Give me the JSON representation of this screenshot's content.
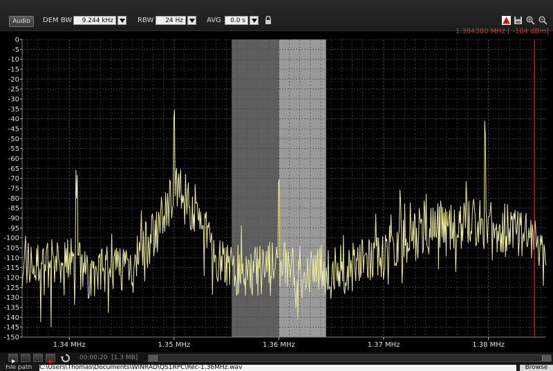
{
  "toolbar": {
    "audio_label": "Audio",
    "dem_bw_label": "DEM BW",
    "dem_bw_value": "9.244 kHz",
    "rbw_label": "RBW",
    "rbw_value": "24 Hz",
    "avg_label": "AVG",
    "avg_value": "0.0 s",
    "cursor_readout": "1.384380 MHz [ -104 dBm]"
  },
  "chart_data": {
    "type": "line",
    "xlabel": "",
    "ylabel": "",
    "xlim": [
      1.3355,
      1.3855
    ],
    "ylim": [
      -150,
      0
    ],
    "x_ticks": [
      "1.34 MHz",
      "1.35 MHz",
      "1.36 MHz",
      "1.37 MHz",
      "1.38 MHz"
    ],
    "x_tick_values": [
      1.34,
      1.35,
      1.36,
      1.37,
      1.38
    ],
    "y_ticks": [
      0,
      -5,
      -10,
      -15,
      -20,
      -25,
      -30,
      -35,
      -40,
      -45,
      -50,
      -55,
      -60,
      -65,
      -70,
      -75,
      -80,
      -85,
      -90,
      -95,
      -100,
      -105,
      -110,
      -115,
      -120,
      -125,
      -130,
      -135,
      -140,
      -145,
      -150
    ],
    "grid": true,
    "filter_band_low": [
      1.3555,
      1.36
    ],
    "filter_band_high": [
      1.36,
      1.3645
    ],
    "cursor_freq": 1.38438,
    "peaks": [
      {
        "x": 1.3407,
        "y": -82
      },
      {
        "x": 1.35,
        "y": -45
      },
      {
        "x": 1.36,
        "y": -80
      },
      {
        "x": 1.3716,
        "y": -88
      },
      {
        "x": 1.3797,
        "y": -53
      }
    ],
    "series": [
      {
        "color": "#ece8a2",
        "envelope_x": [
          1.3355,
          1.338,
          1.34,
          1.342,
          1.344,
          1.346,
          1.348,
          1.35,
          1.352,
          1.354,
          1.356,
          1.358,
          1.36,
          1.362,
          1.364,
          1.366,
          1.368,
          1.37,
          1.372,
          1.374,
          1.376,
          1.378,
          1.38,
          1.382,
          1.384,
          1.3855
        ],
        "envelope_y": [
          -112,
          -117,
          -112,
          -118,
          -116,
          -112,
          -100,
          -76,
          -85,
          -108,
          -116,
          -117,
          -112,
          -117,
          -118,
          -116,
          -113,
          -108,
          -102,
          -96,
          -93,
          -93,
          -94,
          -96,
          -100,
          -101
        ]
      }
    ]
  },
  "transport": {
    "time": "00:00:20",
    "size": "[1.3 MB]"
  },
  "file": {
    "label": "File path",
    "path": "C:\\Users\\Thomas\\Documents\\WINRAD\\QS1RPC\\Rec-1.36MHz.wav",
    "browse_label": "Browse"
  },
  "colors": {
    "trace": "#ece8a2",
    "grid": "#4a4a4a",
    "band_low": "#5e5e5e",
    "band_high": "#9a9a9a",
    "cursor": "#e02020",
    "axis_text": "#e0e0e0"
  }
}
